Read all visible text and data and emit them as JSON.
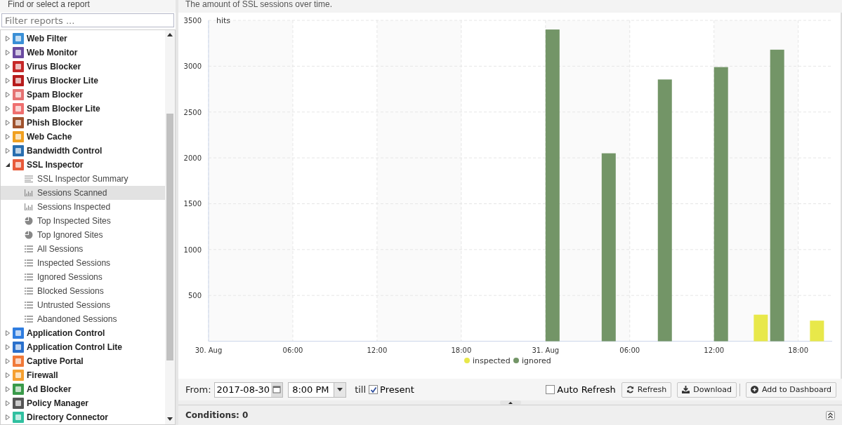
{
  "sidebar": {
    "title": "Find or select a report",
    "filter": {
      "placeholder": "Filter reports ..."
    },
    "tree": [
      {
        "label": "Web Filter",
        "color": "#3a8fd6",
        "expanded": false,
        "selected": false
      },
      {
        "label": "Web Monitor",
        "color": "#6a4aa0",
        "expanded": false,
        "selected": false
      },
      {
        "label": "Virus Blocker",
        "color": "#c62828",
        "expanded": false,
        "selected": false
      },
      {
        "label": "Virus Blocker Lite",
        "color": "#b71c1c",
        "expanded": false,
        "selected": false
      },
      {
        "label": "Spam Blocker",
        "color": "#e57373",
        "expanded": false,
        "selected": false
      },
      {
        "label": "Spam Blocker Lite",
        "color": "#ef6f6f",
        "expanded": false,
        "selected": false
      },
      {
        "label": "Phish Blocker",
        "color": "#a0522d",
        "expanded": false,
        "selected": false
      },
      {
        "label": "Web Cache",
        "color": "#f0a020",
        "expanded": false,
        "selected": false
      },
      {
        "label": "Bandwidth Control",
        "color": "#2a6fb0",
        "expanded": false,
        "selected": false
      },
      {
        "label": "SSL Inspector",
        "color": "#e85a3a",
        "expanded": true,
        "selected": false,
        "children": [
          {
            "label": "SSL Inspector Summary",
            "kind": "text",
            "selected": false
          },
          {
            "label": "Sessions Scanned",
            "kind": "bar",
            "selected": true
          },
          {
            "label": "Sessions Inspected",
            "kind": "bar",
            "selected": false
          },
          {
            "label": "Top Inspected Sites",
            "kind": "pie",
            "selected": false
          },
          {
            "label": "Top Ignored Sites",
            "kind": "pie",
            "selected": false
          },
          {
            "label": "All Sessions",
            "kind": "list",
            "selected": false
          },
          {
            "label": "Inspected Sessions",
            "kind": "list",
            "selected": false
          },
          {
            "label": "Ignored Sessions",
            "kind": "list",
            "selected": false
          },
          {
            "label": "Blocked Sessions",
            "kind": "list",
            "selected": false
          },
          {
            "label": "Untrusted Sessions",
            "kind": "list",
            "selected": false
          },
          {
            "label": "Abandoned Sessions",
            "kind": "list",
            "selected": false
          }
        ]
      },
      {
        "label": "Application Control",
        "color": "#2f7de0",
        "expanded": false,
        "selected": false
      },
      {
        "label": "Application Control Lite",
        "color": "#2a70cc",
        "expanded": false,
        "selected": false
      },
      {
        "label": "Captive Portal",
        "color": "#f07a3a",
        "expanded": false,
        "selected": false
      },
      {
        "label": "Firewall",
        "color": "#f5a030",
        "expanded": false,
        "selected": false
      },
      {
        "label": "Ad Blocker",
        "color": "#3a9a4a",
        "expanded": false,
        "selected": false
      },
      {
        "label": "Policy Manager",
        "color": "#555555",
        "expanded": false,
        "selected": false
      },
      {
        "label": "Directory Connector",
        "color": "#30c0a0",
        "expanded": false,
        "selected": false
      }
    ]
  },
  "report": {
    "description": "The amount of SSL sessions over time.",
    "chart_data": {
      "type": "bar",
      "ylabel": "hits",
      "grid": true,
      "legend": true,
      "x": [
        "2017-08-31T00:30",
        "2017-08-31T04:30",
        "2017-08-31T08:30",
        "2017-08-31T12:30",
        "2017-08-31T15:20",
        "2017-08-31T16:30",
        "2017-08-31T19:20"
      ],
      "xlim": [
        "2017-08-30T00:00",
        "2017-08-31T20:25"
      ],
      "ylim": [
        0,
        3500
      ],
      "xticks": [
        {
          "value": "2017-08-30T00:00",
          "label": "30. Aug"
        },
        {
          "value": "2017-08-30T06:00",
          "label": "06:00"
        },
        {
          "value": "2017-08-30T12:00",
          "label": "12:00"
        },
        {
          "value": "2017-08-30T18:00",
          "label": "18:00"
        },
        {
          "value": "2017-08-31T00:00",
          "label": "31. Aug"
        },
        {
          "value": "2017-08-31T06:00",
          "label": "06:00"
        },
        {
          "value": "2017-08-31T12:00",
          "label": "12:00"
        },
        {
          "value": "2017-08-31T18:00",
          "label": "18:00"
        }
      ],
      "yticks": [
        500,
        1000,
        1500,
        2000,
        2500,
        3000,
        3500
      ],
      "series": [
        {
          "name": "inspected",
          "color": "#e8e84a",
          "values": [
            null,
            null,
            null,
            null,
            290,
            null,
            225
          ]
        },
        {
          "name": "ignored",
          "color": "#739567",
          "values": [
            3400,
            2050,
            2855,
            2990,
            null,
            3180,
            null
          ]
        }
      ]
    }
  },
  "toolbar": {
    "from_label": "From:",
    "date": "2017-08-30",
    "time": "8:00 PM",
    "till_label": "till",
    "present": {
      "label": "Present",
      "checked": true
    },
    "auto_refresh": {
      "label": "Auto Refresh",
      "checked": false
    },
    "buttons": [
      "Refresh",
      "Download",
      "Add to Dashboard"
    ]
  },
  "conditions": {
    "label": "Conditions: 0"
  }
}
